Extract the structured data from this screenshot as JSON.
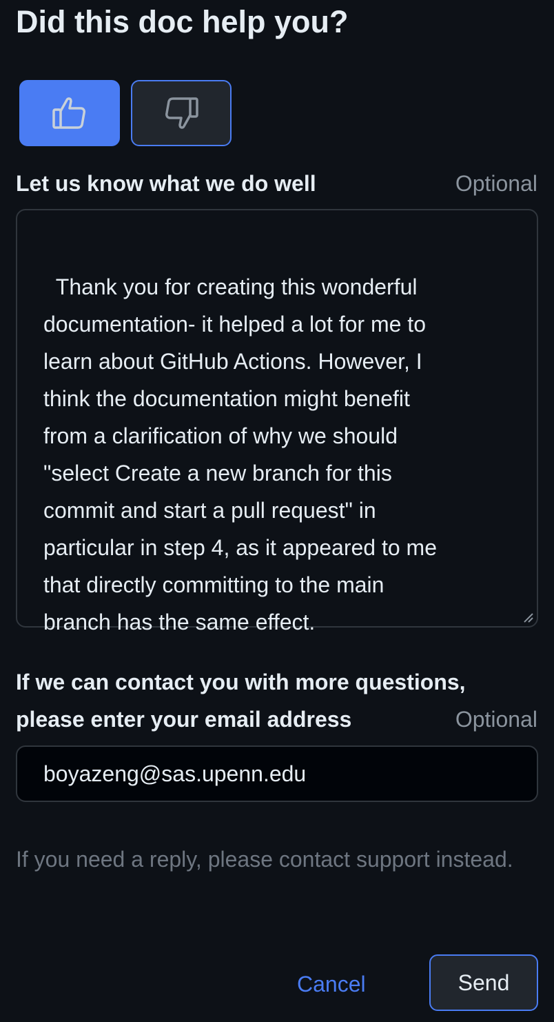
{
  "feedback": {
    "heading": "Did this doc help you?",
    "vote_up_icon": "thumbs-up-icon",
    "vote_down_icon": "thumbs-down-icon",
    "comment_label": "Let us know what we do well",
    "comment_optional": "Optional",
    "comment_value": "Thank you for creating this wonderful\ndocumentation- it helped a lot for me to\nlearn about GitHub Actions. However, I\nthink the documentation might benefit\nfrom a clarification of why we should\n\"select Create a new branch for this\ncommit and start a pull request\" in\nparticular in step 4, as it appeared to me\nthat directly committing to the main\nbranch has the same effect.",
    "email_label_line1": "If we can contact you with more questions,",
    "email_label_line2": "please enter your email address",
    "email_optional": "Optional",
    "email_value": "boyazeng@sas.upenn.edu",
    "note": "If you need a reply, please contact support instead.",
    "cancel_label": "Cancel",
    "send_label": "Send"
  },
  "colors": {
    "background": "#0d1117",
    "accent": "#4a7cf3",
    "text": "#e6edf3",
    "muted": "#8b949e",
    "border": "#30363d"
  }
}
